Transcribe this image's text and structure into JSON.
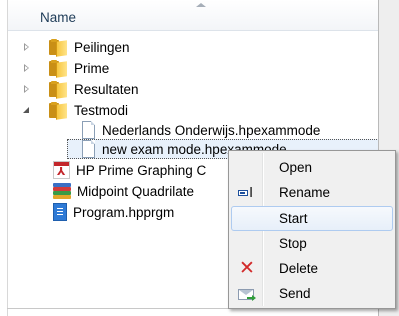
{
  "header": {
    "name_label": "Name"
  },
  "tree": {
    "items": [
      {
        "label": "Peilingen",
        "icon": "folder-icon",
        "expander": "collapsed"
      },
      {
        "label": "Prime",
        "icon": "folder-icon",
        "expander": "collapsed"
      },
      {
        "label": "Resultaten",
        "icon": "folder-icon",
        "expander": "collapsed"
      },
      {
        "label": "Testmodi",
        "icon": "folder-icon",
        "expander": "expanded"
      },
      {
        "label": "Nederlands Onderwijs.hpexammode",
        "icon": "document-icon"
      },
      {
        "label": "new exam mode.hpexammode",
        "icon": "document-icon",
        "selected": true
      },
      {
        "label": "HP Prime Graphing C",
        "icon": "pdf-icon"
      },
      {
        "label": "Midpoint Quadrilate",
        "icon": "books-icon"
      },
      {
        "label": "Program.hpprgm",
        "icon": "program-file-icon"
      }
    ]
  },
  "context_menu": {
    "items": [
      {
        "label": "Open",
        "icon": ""
      },
      {
        "label": "Rename",
        "icon": "rename-icon"
      },
      {
        "label": "Start",
        "icon": "",
        "hovered": true
      },
      {
        "label": "Stop",
        "icon": ""
      },
      {
        "label": "Delete",
        "icon": "delete-icon"
      },
      {
        "label": "Send",
        "icon": "send-icon"
      }
    ]
  },
  "colors": {
    "selection_bg": "#e8f1fb",
    "hover_border": "#aecbf0",
    "menu_bg": "#f0f0f0",
    "folder": "#f7c63f",
    "delete_red": "#d22a2a"
  }
}
